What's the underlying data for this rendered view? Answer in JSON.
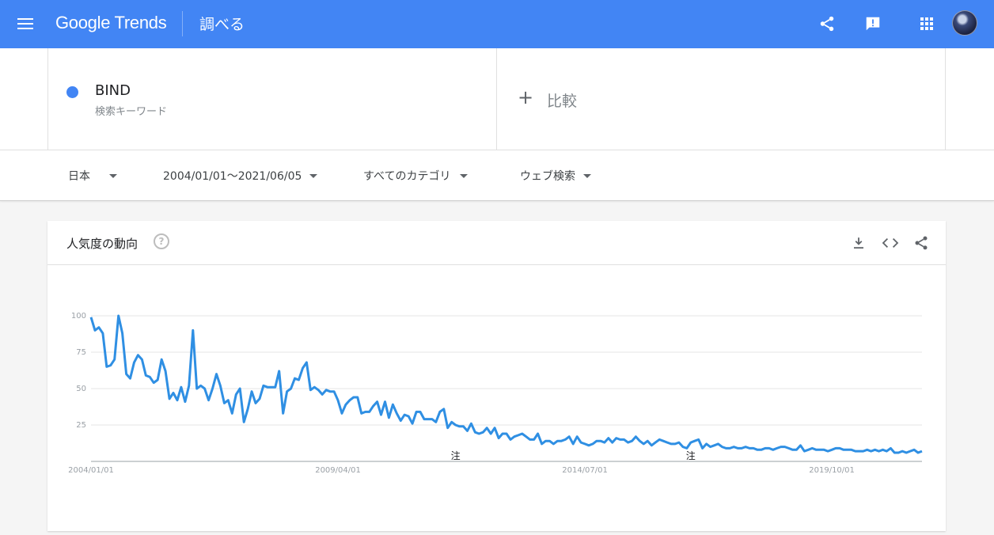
{
  "header": {
    "logo_text": "Google Trends",
    "page_title": "調べる",
    "icons": [
      "menu-icon",
      "share-icon",
      "feedback-icon",
      "apps-icon",
      "avatar"
    ]
  },
  "terms": {
    "term": "BIND",
    "term_type": "検索キーワード",
    "term_color": "#4285f4",
    "compare_label": "比較",
    "compare_symbol": "+"
  },
  "filters": {
    "region": "日本",
    "date_range": "2004/01/01～2021/06/05",
    "category": "すべてのカテゴリ",
    "search_type": "ウェブ検索"
  },
  "card": {
    "title": "人気度の動向",
    "help_symbol": "?",
    "actions": [
      "download-icon",
      "embed-icon",
      "share-icon"
    ]
  },
  "colors": {
    "header_bg": "#4285f4",
    "series": "#2f8fe3"
  },
  "chart_data": {
    "type": "line",
    "title": "人気度の動向",
    "xlabel": "",
    "ylabel": "",
    "ylim": [
      0,
      100
    ],
    "yticks": [
      "100",
      "75",
      "50",
      "25"
    ],
    "xticks": [
      "2004/01/01",
      "2009/04/01",
      "2014/07/01",
      "2019/10/01"
    ],
    "grid": true,
    "legend": "none",
    "x_start": "2004-01",
    "x_step": "1 month",
    "annotations": [
      {
        "text": "注",
        "x": "2011-10"
      },
      {
        "text": "注",
        "x": "2016-10"
      }
    ],
    "series": [
      {
        "name": "BIND",
        "values": [
          99,
          90,
          92,
          88,
          65,
          66,
          70,
          100,
          88,
          60,
          57,
          68,
          73,
          70,
          59,
          58,
          54,
          56,
          70,
          62,
          43,
          47,
          42,
          51,
          41,
          52,
          90,
          50,
          52,
          50,
          42,
          50,
          60,
          52,
          40,
          42,
          33,
          46,
          50,
          27,
          36,
          48,
          40,
          43,
          52,
          51,
          51,
          51,
          62,
          33,
          48,
          50,
          57,
          56,
          64,
          68,
          49,
          51,
          49,
          46,
          49,
          48,
          48,
          42,
          33,
          39,
          42,
          44,
          44,
          33,
          34,
          34,
          38,
          41,
          32,
          41,
          30,
          39,
          33,
          28,
          32,
          31,
          26,
          34,
          34,
          29,
          29,
          29,
          27,
          34,
          36,
          23,
          27,
          25,
          24,
          24,
          21,
          26,
          20,
          19,
          20,
          23,
          19,
          23,
          16,
          19,
          19,
          15,
          17,
          18,
          19,
          17,
          15,
          15,
          19,
          12,
          14,
          14,
          12,
          14,
          14,
          15,
          17,
          12,
          17,
          13,
          12,
          11,
          12,
          14,
          14,
          13,
          16,
          13,
          16,
          15,
          15,
          13,
          14,
          17,
          14,
          12,
          14,
          11,
          13,
          15,
          14,
          13,
          12,
          12,
          13,
          10,
          9,
          13,
          14,
          15,
          9,
          12,
          10,
          11,
          12,
          10,
          9,
          9,
          10,
          9,
          9,
          10,
          9,
          9,
          8,
          8,
          9,
          9,
          8,
          9,
          10,
          10,
          9,
          8,
          8,
          11,
          7,
          8,
          9,
          8,
          8,
          8,
          7,
          8,
          9,
          9,
          8,
          8,
          8,
          7,
          7,
          7,
          8,
          7,
          8,
          7,
          8,
          7,
          9,
          6,
          6,
          7,
          6,
          7,
          8,
          6,
          7
        ]
      }
    ]
  }
}
